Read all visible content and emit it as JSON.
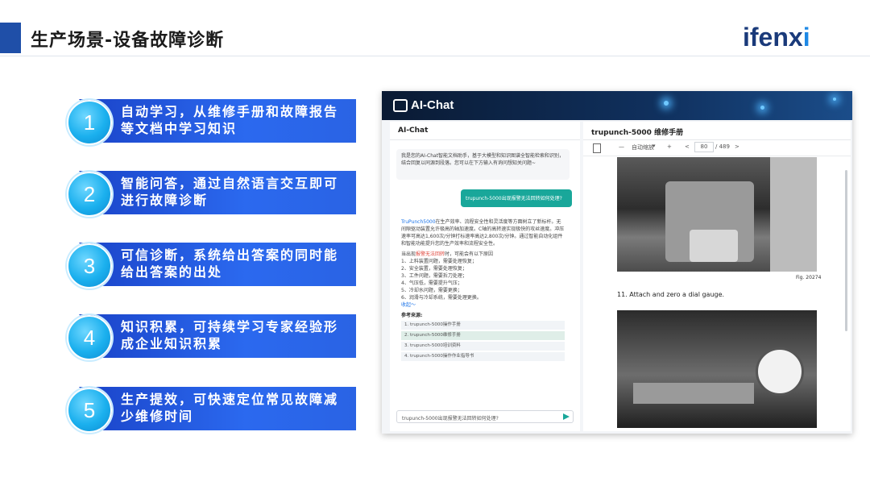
{
  "page": {
    "title": "生产场景-设备故障诊断",
    "logo_main": "ifenx",
    "logo_last": "i"
  },
  "features": [
    {
      "num": "1",
      "text": "自动学习，从维修手册和故障报告等文档中学习知识"
    },
    {
      "num": "2",
      "text": "智能问答，通过自然语言交互即可进行故障诊断"
    },
    {
      "num": "3",
      "text": "可信诊断，系统给出答案的同时能给出答案的出处"
    },
    {
      "num": "4",
      "text": "知识积累，可持续学习专家经验形成企业知识积累"
    },
    {
      "num": "5",
      "text": "生产提效，可快速定位常见故障减少维修时间"
    }
  ],
  "app": {
    "logo": "AI-Chat",
    "left_title": "AI-Chat",
    "right_title": "trupunch-5000 维修手册",
    "bot_intro": "我是您的AI-Chat智能文档助手，基于大模型和知识图谱全智能检索和识别，结合回复以同源到段落。您可以在下方输入有询问想知关问题~",
    "user_question": "trupunch-5000出现报警无法回转如何处理?",
    "answer_p1_link": "TruPunch5000",
    "answer_p1": "在生产效率、流程安全性和灵活度等方面树立了新标杆。无间隙驱动装置允许极高的轴加速度。C轴的高转速实现极快的攻丝速度。冲压速率可高达1,600次/分钟打标速率高达2,800次/分钟。通过智能自动化组件和智能功能提升您的生产效率和流程安全性。",
    "answer_intro_pre": "当出现",
    "answer_intro_red": "报警无法回转",
    "answer_intro_post": "时，可能会有以下原因",
    "causes": [
      "1、上料装置问题，需要处理恢复；",
      "2、安全装置，需要处理恢复；",
      "3、工件问题，需要拆刀处理；",
      "4、气压低，需要提升气压；",
      "5、冷却水问题，需要更换；",
      "6、润滑与冷却系统，需要处理更换。"
    ],
    "collapse": "收起～",
    "ref_title": "参考来源:",
    "refs": [
      "1. trupunch-5000操作手册",
      "2. trupunch-5000维修手册",
      "3. trupunch-5000培训资料",
      "4. trupunch-5000操作作业指导书"
    ],
    "input_value": "trupunch-5000出现报警无法回转如何处理?",
    "toolbar": {
      "minus": "—",
      "zoom": "自动缩放",
      "plus": "+",
      "prev": "<",
      "page": "80",
      "total": "/ 489",
      "next": ">"
    },
    "fig_label": "Fig. 20274",
    "step_text": "11.  Attach and zero a dial gauge."
  },
  "colors": {
    "title_bar": "#1f4fa8",
    "feature_band": "#2b69ef",
    "user_bubble": "#19a79a"
  }
}
